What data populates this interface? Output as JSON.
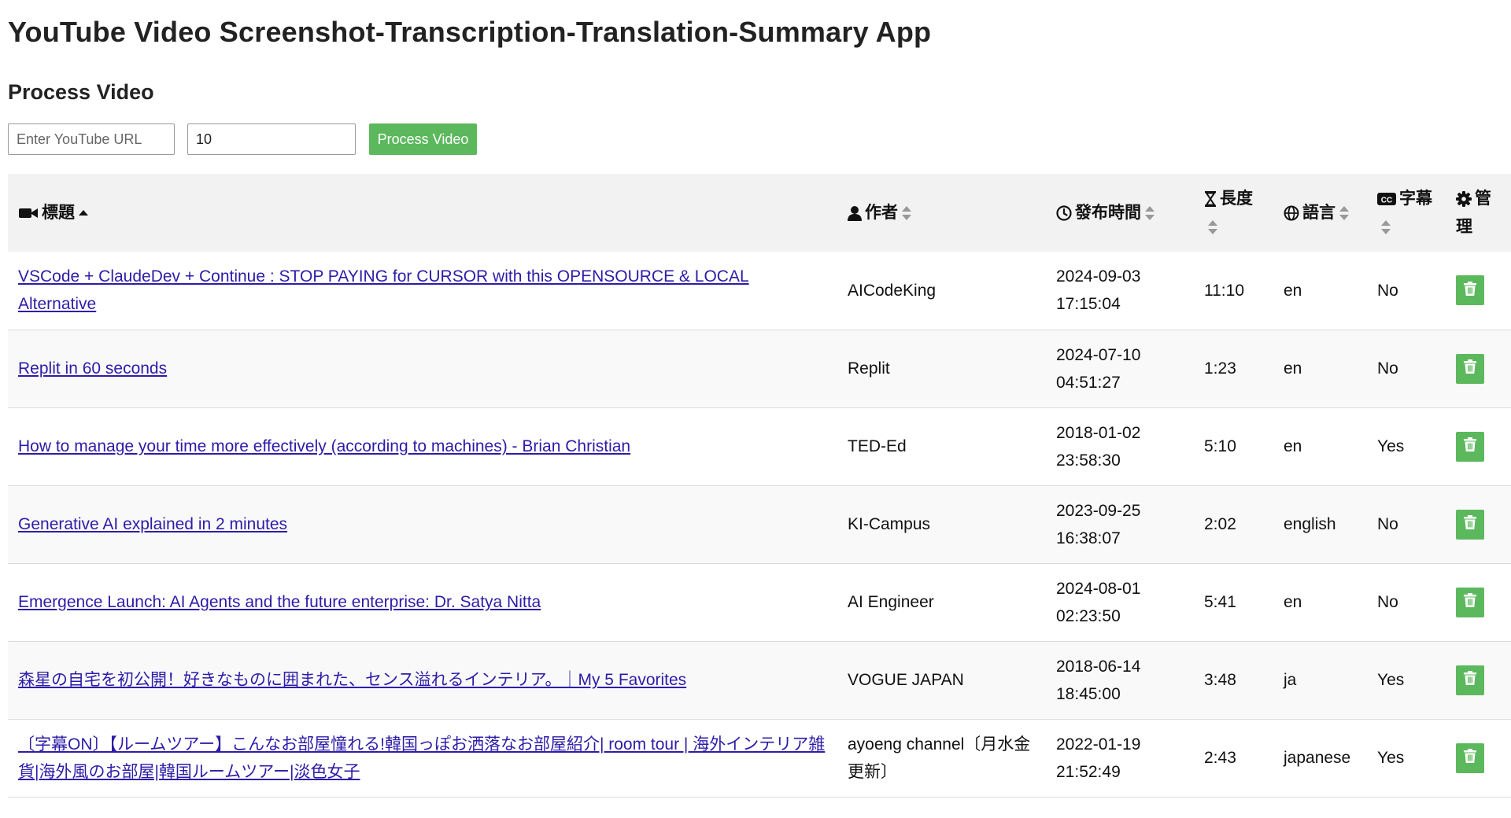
{
  "app": {
    "title": "YouTube Video Screenshot-Transcription-Translation-Summary App"
  },
  "process": {
    "heading": "Process Video",
    "url_placeholder": "Enter YouTube URL",
    "url_value": "",
    "count_value": "10",
    "button_label": "Process Video"
  },
  "colors": {
    "accent_green": "#5cb85c",
    "link": "#2d1ca8",
    "header_bg": "#f2f2f2"
  },
  "table": {
    "headers": {
      "title": "標題",
      "author": "作者",
      "published": "發布時間",
      "duration": "長度",
      "language": "語言",
      "subtitles": "字幕",
      "manage": "管理"
    },
    "header_icons": {
      "title": "video-camera-icon",
      "author": "user-icon",
      "published": "clock-icon",
      "duration": "hourglass-icon",
      "language": "globe-icon",
      "subtitles": "closed-captions-icon",
      "manage": "gear-icon"
    },
    "sorted_column": "title",
    "rows": [
      {
        "title": "VSCode + ClaudeDev + Continue : STOP PAYING for CURSOR with this OPENSOURCE & LOCAL Alternative",
        "author": "AICodeKing",
        "date": "2024-09-03",
        "time": "17:15:04",
        "duration": "11:10",
        "language": "en",
        "subtitles": "No",
        "action_icon": "trash-icon"
      },
      {
        "title": "Replit in 60 seconds",
        "author": "Replit",
        "date": "2024-07-10",
        "time": "04:51:27",
        "duration": "1:23",
        "language": "en",
        "subtitles": "No",
        "action_icon": "trash-icon"
      },
      {
        "title": "How to manage your time more effectively (according to machines) - Brian Christian",
        "author": "TED-Ed",
        "date": "2018-01-02",
        "time": "23:58:30",
        "duration": "5:10",
        "language": "en",
        "subtitles": "Yes",
        "action_icon": "trash-icon"
      },
      {
        "title": "Generative AI explained in 2 minutes",
        "author": "KI-Campus",
        "date": "2023-09-25",
        "time": "16:38:07",
        "duration": "2:02",
        "language": "english",
        "subtitles": "No",
        "action_icon": "trash-icon"
      },
      {
        "title": "Emergence Launch: AI Agents and the future enterprise: Dr. Satya Nitta",
        "author": "AI Engineer",
        "date": "2024-08-01",
        "time": "02:23:50",
        "duration": "5:41",
        "language": "en",
        "subtitles": "No",
        "action_icon": "trash-icon"
      },
      {
        "title": "森星の自宅を初公開！好きなものに囲まれた、センス溢れるインテリア。｜My 5 Favorites",
        "author": "VOGUE JAPAN",
        "date": "2018-06-14",
        "time": "18:45:00",
        "duration": "3:48",
        "language": "ja",
        "subtitles": "Yes",
        "action_icon": "trash-icon"
      },
      {
        "title": "〔字幕ON〕【ルームツアー】こんなお部屋憧れる!韓国っぽお洒落なお部屋紹介| room tour | 海外インテリア雑貨|海外風のお部屋|韓国ルームツアー|淡色女子",
        "author": "ayoeng channel〔月水金更新〕",
        "date": "2022-01-19",
        "time": "21:52:49",
        "duration": "2:43",
        "language": "japanese",
        "subtitles": "Yes",
        "action_icon": "trash-icon"
      }
    ]
  }
}
